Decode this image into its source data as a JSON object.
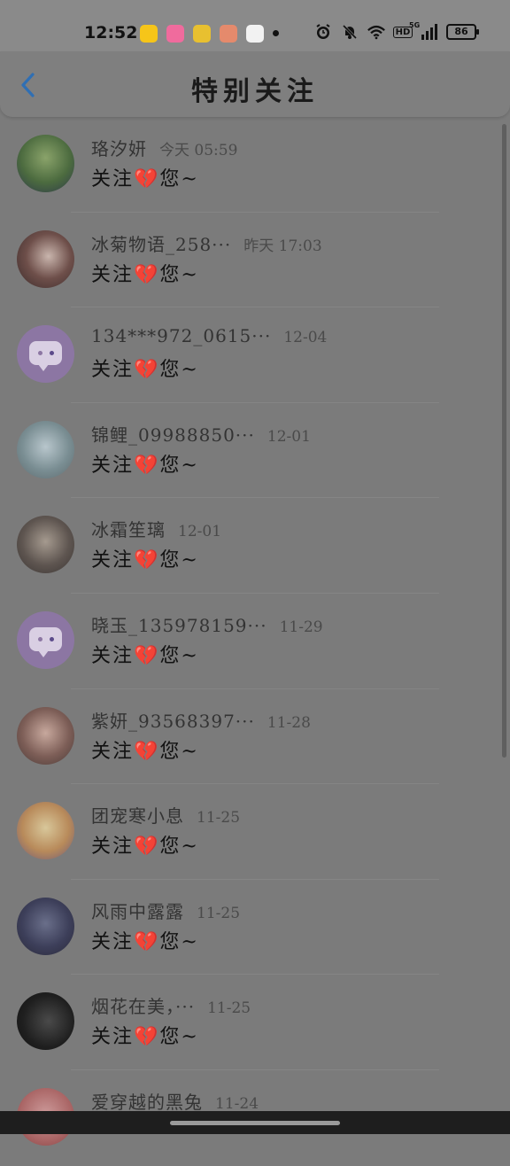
{
  "status_bar": {
    "time": "12:52",
    "battery": "86",
    "hd": "HD",
    "network": "5G",
    "app_icons": [
      "kuaishou-app",
      "bilibili-app",
      "gift-app",
      "pig-app",
      "baby-app"
    ],
    "system_icons": [
      "alarm-icon",
      "mute-icon",
      "wifi-icon",
      "hd-icon",
      "signal-icon",
      "battery-icon"
    ]
  },
  "header": {
    "title": "特别关注",
    "back_icon": "chevron-left-icon",
    "accent_color": "#2f6fb4"
  },
  "items": [
    {
      "name": "珞汐妍",
      "time": "今天 05:59",
      "message": "关注💔您~",
      "avatar": "green-anime-avatar"
    },
    {
      "name": "冰菊物语_258···",
      "time": "昨天 17:03",
      "message": "关注💔您~",
      "avatar": "anime-girl-avatar"
    },
    {
      "name": "134***972_0615···",
      "time": "12-04",
      "message": "关注💔您~",
      "avatar": "default-chat-avatar"
    },
    {
      "name": "锦鲤_09988850···",
      "time": "12-01",
      "message": "关注💔您~",
      "avatar": "anime-fairy-avatar"
    },
    {
      "name": "冰霜笙璃",
      "time": "12-01",
      "message": "关注💔您~",
      "avatar": "couple-avatar"
    },
    {
      "name": "晓玉_135978159···",
      "time": "11-29",
      "message": "关注💔您~",
      "avatar": "default-chat-avatar"
    },
    {
      "name": "紫妍_93568397···",
      "time": "11-28",
      "message": "关注💔您~",
      "avatar": "anime-girl-avatar"
    },
    {
      "name": "团宠寒小息",
      "time": "11-25",
      "message": "关注💔您~",
      "avatar": "cartoon-girl-avatar"
    },
    {
      "name": "风雨中露露",
      "time": "11-25",
      "message": "关注💔您~",
      "avatar": "group-avatar"
    },
    {
      "name": "烟花在美，···",
      "time": "11-25",
      "message": "关注💔您~",
      "avatar": "dark-photo-avatar"
    },
    {
      "name": "爱穿越的黑兔",
      "time": "11-24",
      "message": "",
      "avatar": "red-avatar"
    }
  ]
}
